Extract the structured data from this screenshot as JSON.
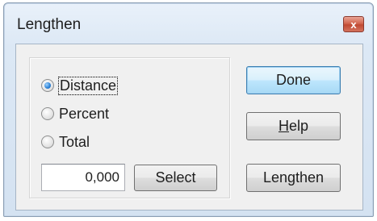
{
  "window": {
    "title": "Lengthen",
    "close_glyph": "x"
  },
  "options": [
    {
      "label": "Distance",
      "checked": true
    },
    {
      "label": "Percent",
      "checked": false
    },
    {
      "label": "Total",
      "checked": false
    }
  ],
  "value_field": {
    "value": "0,000"
  },
  "buttons": {
    "select": "Select",
    "done": "Done",
    "help_mnemonic": "H",
    "help_rest": "elp",
    "lengthen": "Lengthen"
  }
}
